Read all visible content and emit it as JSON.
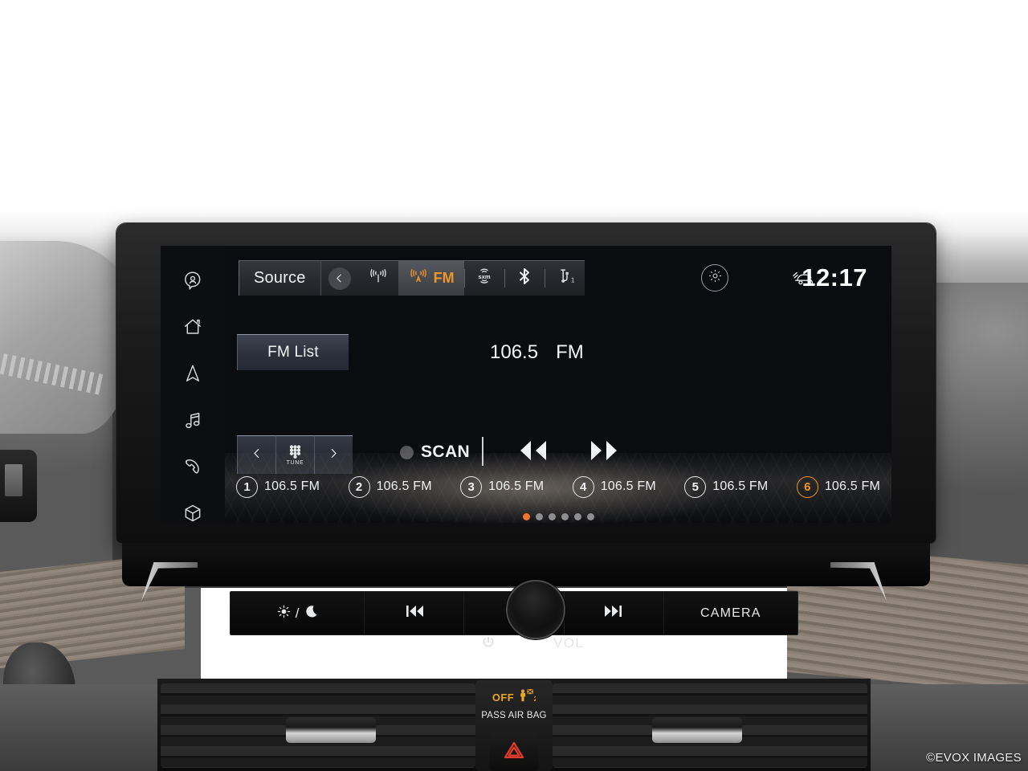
{
  "sidebar": {
    "items": [
      {
        "name": "profile",
        "icon": "user-bubble-icon"
      },
      {
        "name": "home",
        "icon": "home-icon"
      },
      {
        "name": "navigation",
        "icon": "navigation-arrow-icon"
      },
      {
        "name": "media",
        "icon": "music-note-icon"
      },
      {
        "name": "phone",
        "icon": "phone-icon"
      },
      {
        "name": "apps",
        "icon": "cube-icon"
      }
    ]
  },
  "topbar": {
    "source_label": "Source",
    "back_icon": "chevron-left-icon",
    "tabs": [
      {
        "id": "am",
        "label": "",
        "icon": "radio-antenna-icon",
        "active": false
      },
      {
        "id": "fm",
        "label": "FM",
        "icon": "fm-antenna-icon",
        "active": true
      },
      {
        "id": "sxm",
        "label": "sxm",
        "icon": "siriusxm-icon",
        "active": false
      },
      {
        "id": "bt",
        "label": "",
        "icon": "bluetooth-icon",
        "active": false
      },
      {
        "id": "usb",
        "label": "1",
        "icon": "usb-icon",
        "active": false
      }
    ],
    "settings_icon": "gear-icon",
    "vehicle_icon": "car-key-icon",
    "clock": "12:17"
  },
  "now_playing": {
    "fm_list_label": "FM List",
    "frequency": "106.5",
    "band": "FM"
  },
  "transport": {
    "prev_icon": "chevron-left-icon",
    "tune_label": "TUNE",
    "tune_icon": "keypad-dots-icon",
    "next_icon": "chevron-right-icon",
    "scan_label": "SCAN",
    "rewind_icon": "rewind-icon",
    "forward_icon": "fast-forward-icon"
  },
  "presets": [
    {
      "number": "1",
      "station": "106.5 FM",
      "highlighted": false
    },
    {
      "number": "2",
      "station": "106.5 FM",
      "highlighted": false
    },
    {
      "number": "3",
      "station": "106.5 FM",
      "highlighted": false
    },
    {
      "number": "4",
      "station": "106.5 FM",
      "highlighted": false
    },
    {
      "number": "5",
      "station": "106.5 FM",
      "highlighted": false
    },
    {
      "number": "6",
      "station": "106.5 FM",
      "highlighted": true
    }
  ],
  "pagination": {
    "total": 6,
    "active_index": 0
  },
  "hard_buttons": {
    "day_night_label": "/",
    "day_night_icons": [
      "sun-icon",
      "moon-icon"
    ],
    "prev_track_icon": "skip-back-icon",
    "next_track_icon": "skip-forward-icon",
    "camera_label": "CAMERA",
    "power_icon": "power-icon",
    "volume_label": "VOL"
  },
  "center_stack": {
    "airbag_status": "OFF",
    "airbag_label": "PASS AIR BAG",
    "airbag_icon": "passenger-airbag-off-icon",
    "hazard_icon": "hazard-triangle-icon"
  },
  "watermark": "©EVOX IMAGES",
  "colors": {
    "accent_orange": "#F0952C",
    "pagination_active": "#F0752C",
    "airbag_amber": "#E8A62A",
    "hazard_red": "#E23C2A",
    "screen_bg": "#0A0C10",
    "text_primary": "#F1F2F4"
  }
}
